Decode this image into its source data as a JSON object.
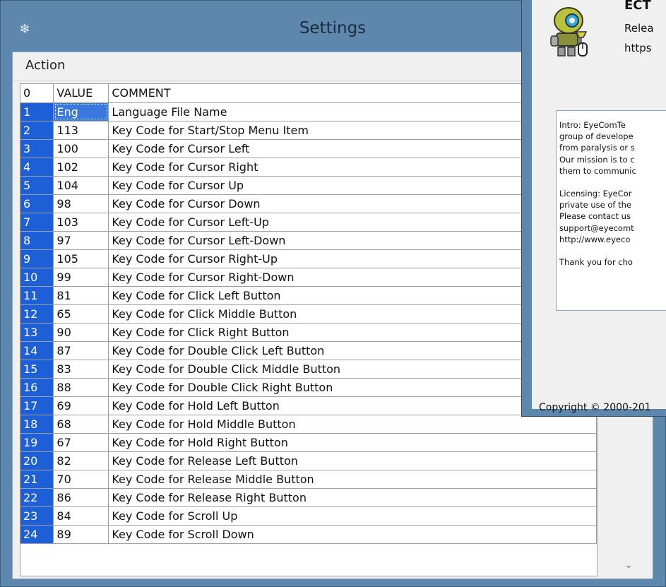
{
  "window": {
    "title": "Settings",
    "app_icon": "snowflake-icon"
  },
  "menu": {
    "action_label": "Action"
  },
  "table": {
    "headers": {
      "index": "0",
      "value": "VALUE",
      "comment": "COMMENT"
    },
    "rows": [
      {
        "index": "1",
        "value": "Eng",
        "comment": "Language File Name"
      },
      {
        "index": "2",
        "value": "113",
        "comment": "Key Code for Start/Stop Menu Item"
      },
      {
        "index": "3",
        "value": "100",
        "comment": "Key Code for Cursor Left"
      },
      {
        "index": "4",
        "value": "102",
        "comment": "Key Code for Cursor Right"
      },
      {
        "index": "5",
        "value": "104",
        "comment": "Key Code for Cursor Up"
      },
      {
        "index": "6",
        "value": "98",
        "comment": "Key Code for Cursor Down"
      },
      {
        "index": "7",
        "value": "103",
        "comment": "Key Code for Cursor Left-Up"
      },
      {
        "index": "8",
        "value": "97",
        "comment": "Key Code for Cursor Left-Down"
      },
      {
        "index": "9",
        "value": "105",
        "comment": "Key Code for Cursor Right-Up"
      },
      {
        "index": "10",
        "value": "99",
        "comment": "Key Code for Cursor Right-Down"
      },
      {
        "index": "11",
        "value": "81",
        "comment": "Key Code for Click Left Button"
      },
      {
        "index": "12",
        "value": "65",
        "comment": "Key Code for Click Middle Button"
      },
      {
        "index": "13",
        "value": "90",
        "comment": "Key Code for Click Right Button"
      },
      {
        "index": "14",
        "value": "87",
        "comment": "Key Code for Double Click Left Button"
      },
      {
        "index": "15",
        "value": "83",
        "comment": "Key Code for Double Click Middle Button"
      },
      {
        "index": "16",
        "value": "88",
        "comment": "Key Code for Double Click Right Button"
      },
      {
        "index": "17",
        "value": "69",
        "comment": "Key Code for Hold Left Button"
      },
      {
        "index": "18",
        "value": "68",
        "comment": "Key Code for Hold Middle Button"
      },
      {
        "index": "19",
        "value": "67",
        "comment": "Key Code for Hold Right Button"
      },
      {
        "index": "20",
        "value": "82",
        "comment": "Key Code for Release Left Button"
      },
      {
        "index": "21",
        "value": "70",
        "comment": "Key Code for Release Middle Button"
      },
      {
        "index": "22",
        "value": "86",
        "comment": "Key Code for Release Right Button"
      },
      {
        "index": "23",
        "value": "84",
        "comment": "Key Code for Scroll Up"
      },
      {
        "index": "24",
        "value": "89",
        "comment": "Key Code for Scroll Down"
      }
    ],
    "selected_row": "1"
  },
  "scrollbar": {
    "down_icon": "chevron-down-icon"
  },
  "about": {
    "title": "ECT",
    "release": "Relea",
    "link": "https",
    "logo_icon": "robot-logo-icon",
    "text_lines_1": [
      "Intro: EyeComTe",
      "group of develope",
      "from paralysis or s",
      "Our mission is to c",
      "them to communic"
    ],
    "text_lines_2": [
      "Licensing: EyeCor",
      "private use of the",
      "Please contact us",
      "support@eyecomt",
      "http://www.eyeco"
    ],
    "text_lines_3": [
      "Thank you for cho"
    ],
    "copyright": "Copyright © 2000-201"
  },
  "colors": {
    "titlebar": "#5e87ad",
    "fixed_column": "#1c5fd6",
    "selection": "#3a78de"
  }
}
